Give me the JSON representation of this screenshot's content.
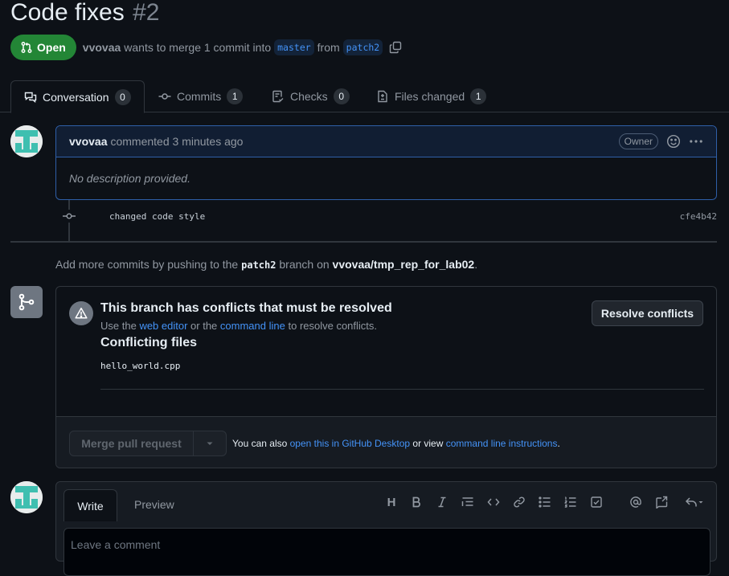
{
  "pr": {
    "title": "Code fixes",
    "number": "#2",
    "state": "Open",
    "author": "vvovaa",
    "merge_text": "wants to merge 1 commit into",
    "base_branch": "master",
    "from_text": "from",
    "head_branch": "patch2"
  },
  "tabs": [
    {
      "label": "Conversation",
      "count": "0"
    },
    {
      "label": "Commits",
      "count": "1"
    },
    {
      "label": "Checks",
      "count": "0"
    },
    {
      "label": "Files changed",
      "count": "1"
    }
  ],
  "comment": {
    "author": "vvovaa",
    "action": "commented 3 minutes ago",
    "role": "Owner",
    "body": "No description provided."
  },
  "commit": {
    "message": "changed code style",
    "sha": "cfe4b42"
  },
  "push_hint": {
    "prefix": "Add more commits by pushing to the",
    "branch": "patch2",
    "middle": "branch on",
    "repo": "vvovaa/tmp_rep_for_lab02",
    "suffix": "."
  },
  "mergebox": {
    "title": "This branch has conflicts that must be resolved",
    "sub_prefix": "Use the",
    "web_editor": "web editor",
    "sub_or": "or the",
    "command_line": "command line",
    "sub_suffix": "to resolve conflicts.",
    "files_heading": "Conflicting files",
    "file": "hello_world.cpp",
    "resolve_button": "Resolve conflicts",
    "merge_button": "Merge pull request",
    "also_prefix": "You can also",
    "desktop_link": "open this in GitHub Desktop",
    "also_or": "or view",
    "cli_link": "command line instructions",
    "also_suffix": "."
  },
  "new_comment": {
    "write_tab": "Write",
    "preview_tab": "Preview",
    "heading_tool": "H",
    "placeholder": "Leave a comment"
  }
}
